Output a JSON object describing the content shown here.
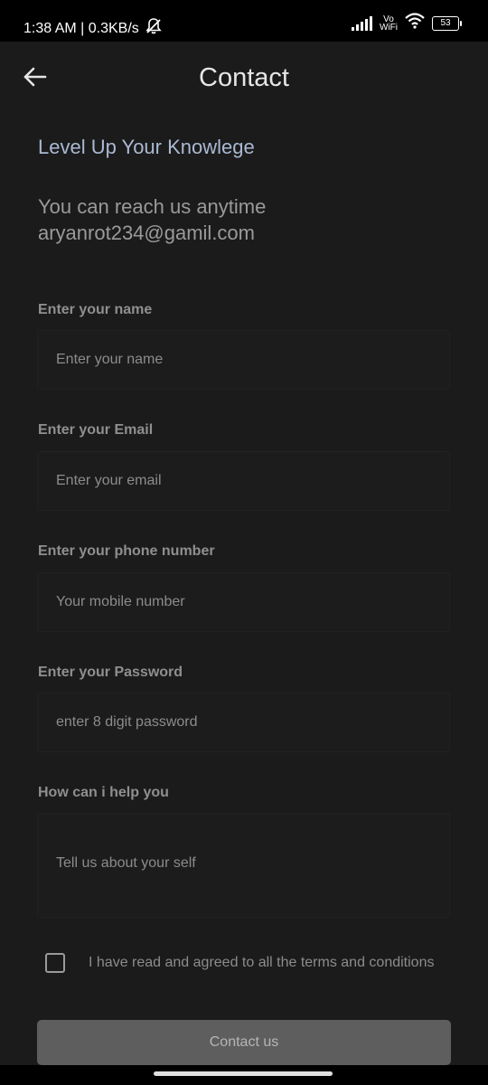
{
  "status_bar": {
    "time_speed": "1:38 AM | 0.3KB/s",
    "vo_label": "Vo",
    "wifi_label": "WiFi",
    "battery": "53"
  },
  "header": {
    "title": "Contact"
  },
  "intro": {
    "tagline": "Level Up Your Knowlege",
    "reach_line1": "You can reach us anytime",
    "reach_line2": "aryanrot234@gamil.com"
  },
  "form": {
    "name": {
      "label": "Enter your name",
      "placeholder": "Enter your name",
      "value": ""
    },
    "email": {
      "label": "Enter your Email",
      "placeholder": "Enter your email",
      "value": ""
    },
    "phone": {
      "label": "Enter your phone number",
      "placeholder": "Your mobile number",
      "value": ""
    },
    "password": {
      "label": "Enter your Password",
      "placeholder": "enter 8 digit password",
      "value": ""
    },
    "help": {
      "label": "How can i help you",
      "placeholder": "Tell us about your self",
      "value": ""
    }
  },
  "terms": {
    "text": "I have read and agreed to all the terms and conditions",
    "checked": false
  },
  "submit": {
    "label": "Contact us"
  },
  "colors": {
    "background": "#1b1b1b",
    "tagline": "#aab9d3",
    "button": "#5e5e5e"
  }
}
